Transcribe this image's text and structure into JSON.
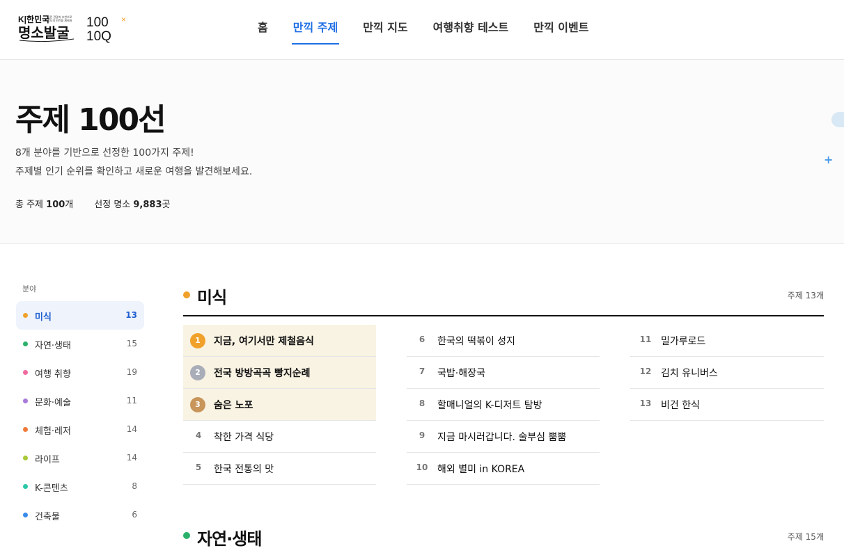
{
  "header": {
    "logo_text": "대한민국 명소발굴",
    "logo_small": "국민 관광지 추천으로 지도의 빈칸을 채워봐",
    "logo_100": "100 100Q",
    "nav": [
      {
        "label": "홈",
        "active": false
      },
      {
        "label": "만끽 주제",
        "active": true
      },
      {
        "label": "만끽 지도",
        "active": false
      },
      {
        "label": "여행취향 테스트",
        "active": false
      },
      {
        "label": "만끽 이벤트",
        "active": false
      }
    ]
  },
  "hero": {
    "title": "주제 100선",
    "desc1": "8개 분야를 기반으로 선정한 100가지 주제!",
    "desc2": "주제별 인기 순위를 확인하고 새로운 여행을 발견해보세요.",
    "stat1_prefix": "총 주제 ",
    "stat1_value": "100",
    "stat1_suffix": "개",
    "stat2_prefix": "선정 명소 ",
    "stat2_value": "9,883",
    "stat2_suffix": "곳",
    "plus_icon": "+"
  },
  "sidebar": {
    "title": "분야",
    "items": [
      {
        "label": "미식",
        "count": "13",
        "color": "#f0a12a",
        "active": true
      },
      {
        "label": "자연·생태",
        "count": "15",
        "color": "#2ab06a",
        "active": false
      },
      {
        "label": "여행 취향",
        "count": "19",
        "color": "#f06aa0",
        "active": false
      },
      {
        "label": "문화·예술",
        "count": "11",
        "color": "#a87ad8",
        "active": false
      },
      {
        "label": "체험·레저",
        "count": "14",
        "color": "#f07a3a",
        "active": false
      },
      {
        "label": "라이프",
        "count": "14",
        "color": "#a8c83a",
        "active": false
      },
      {
        "label": "K-콘텐츠",
        "count": "8",
        "color": "#2ac8a8",
        "active": false
      },
      {
        "label": "건축물",
        "count": "6",
        "color": "#3a8ae8",
        "active": false
      }
    ]
  },
  "sections": [
    {
      "title": "미식",
      "count": "주제 13개",
      "color": "#f0a12a"
    },
    {
      "title": "자연·생태",
      "count": "주제 15개",
      "color": "#2ab06a"
    }
  ],
  "topics": {
    "col1": [
      {
        "rank": "1",
        "label": "지금, 여기서만 제철음식",
        "highlight": true,
        "badge_color": "#f0a12a"
      },
      {
        "rank": "2",
        "label": "전국 방방곡곡 빵지순례",
        "highlight": true,
        "badge_color": "#a9adb8"
      },
      {
        "rank": "3",
        "label": "숨은 노포",
        "highlight": true,
        "badge_color": "#c8955a"
      },
      {
        "rank": "4",
        "label": "착한 가격 식당",
        "highlight": false
      },
      {
        "rank": "5",
        "label": "한국 전통의 맛",
        "highlight": false
      }
    ],
    "col2": [
      {
        "rank": "6",
        "label": "한국의 떡볶이 성지",
        "highlight": false
      },
      {
        "rank": "7",
        "label": "국밥·해장국",
        "highlight": false
      },
      {
        "rank": "8",
        "label": "할매니얼의 K-디저트 탐방",
        "highlight": false
      },
      {
        "rank": "9",
        "label": "지금 마시러갑니다. 술부심 뿜뿜",
        "highlight": false
      },
      {
        "rank": "10",
        "label": "해외 별미 in KOREA",
        "highlight": false
      }
    ],
    "col3": [
      {
        "rank": "11",
        "label": "밀가루로드",
        "highlight": false
      },
      {
        "rank": "12",
        "label": "김치 유니버스",
        "highlight": false
      },
      {
        "rank": "13",
        "label": "비건 한식",
        "highlight": false
      }
    ]
  }
}
